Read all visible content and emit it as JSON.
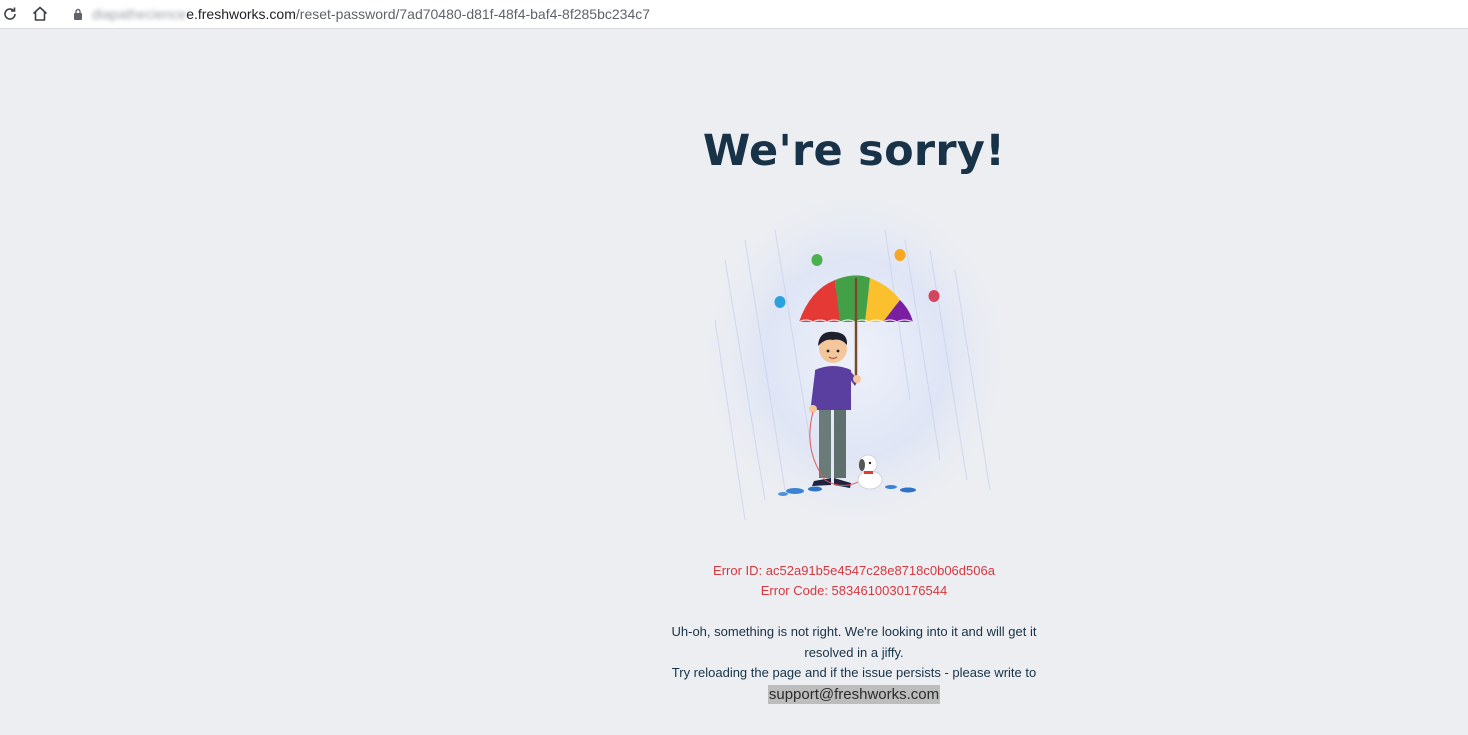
{
  "browser": {
    "url_blurred": "diapathecience",
    "url_host": "e.freshworks.com",
    "url_path": "/reset-password/7ad70480-d81f-48f4-baf4-8f285bc234c7"
  },
  "page": {
    "title": "We're sorry!",
    "error_id": "Error ID: ac52a91b5e4547c28e8718c0b06d506a",
    "error_code": "Error Code: 5834610030176544",
    "message_line1": "Uh-oh, something is not right. We're looking into it and will get it resolved in a jiffy.",
    "message_line2": "Try reloading the page and if the issue persists - please write to",
    "support_email": "support@freshworks.com"
  },
  "colors": {
    "background": "#eceef2",
    "title": "#183247",
    "error": "#d7373f",
    "email_highlight": "#bdbdbd"
  },
  "icons": {
    "reload": "reload-icon",
    "home": "home-icon",
    "lock": "lock-icon"
  }
}
